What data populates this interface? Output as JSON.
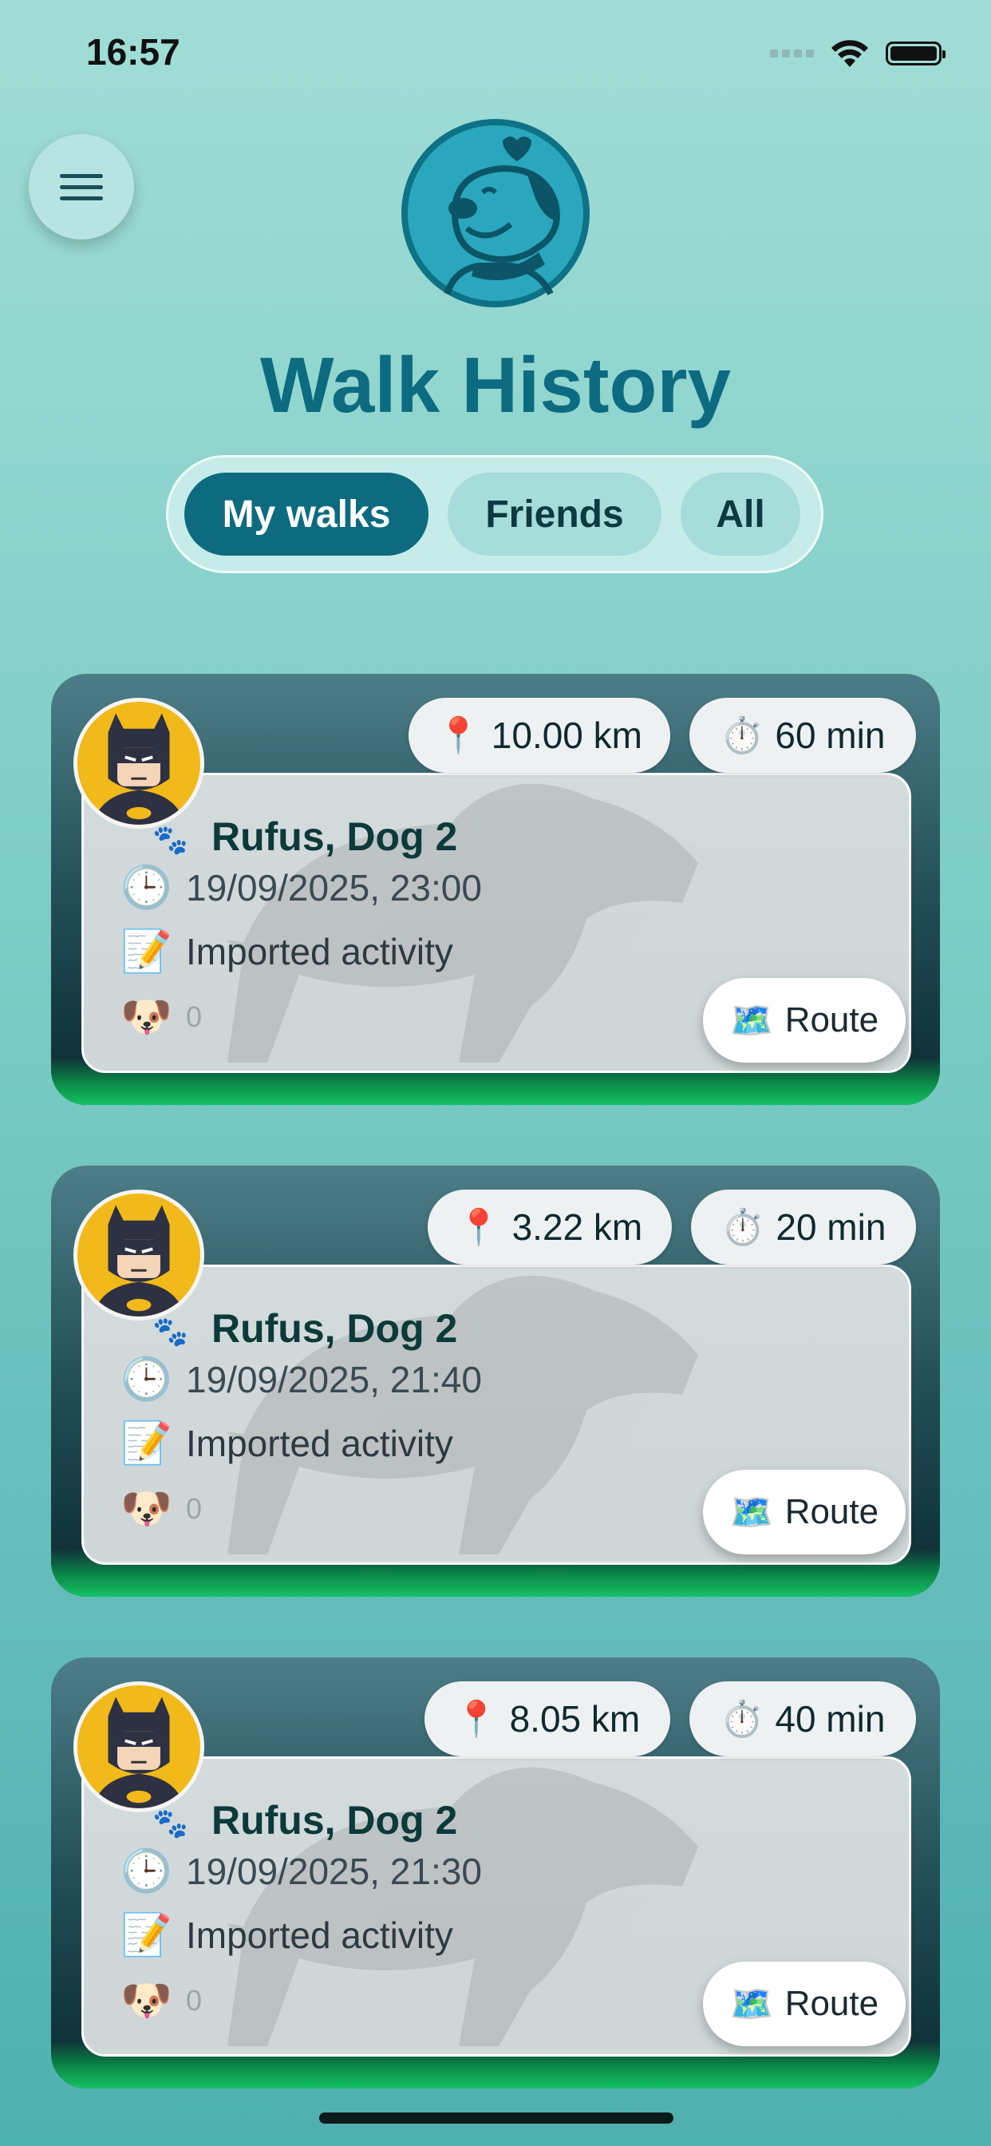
{
  "status_bar": {
    "time": "16:57"
  },
  "header": {
    "title": "Walk History"
  },
  "tabs": [
    {
      "label": "My walks",
      "active": true
    },
    {
      "label": "Friends",
      "active": false
    },
    {
      "label": "All",
      "active": false
    }
  ],
  "walks": [
    {
      "distance": "10.00 km",
      "duration": "60 min",
      "dogs": "Rufus, Dog 2",
      "datetime": "19/09/2025, 23:00",
      "note": "Imported activity",
      "count": "0",
      "route_label": "Route"
    },
    {
      "distance": "3.22 km",
      "duration": "20 min",
      "dogs": "Rufus, Dog 2",
      "datetime": "19/09/2025, 21:40",
      "note": "Imported activity",
      "count": "0",
      "route_label": "Route"
    },
    {
      "distance": "8.05 km",
      "duration": "40 min",
      "dogs": "Rufus, Dog 2",
      "datetime": "19/09/2025, 21:30",
      "note": "Imported activity",
      "count": "0",
      "route_label": "Route"
    }
  ],
  "icons": {
    "distance": "📍",
    "duration": "⏱️",
    "time": "🕒",
    "note": "📝",
    "dog": "🐶",
    "route": "🗺️"
  },
  "colors": {
    "accent": "#0d6b80",
    "title": "#0c6b80",
    "grass": "#14c263"
  }
}
